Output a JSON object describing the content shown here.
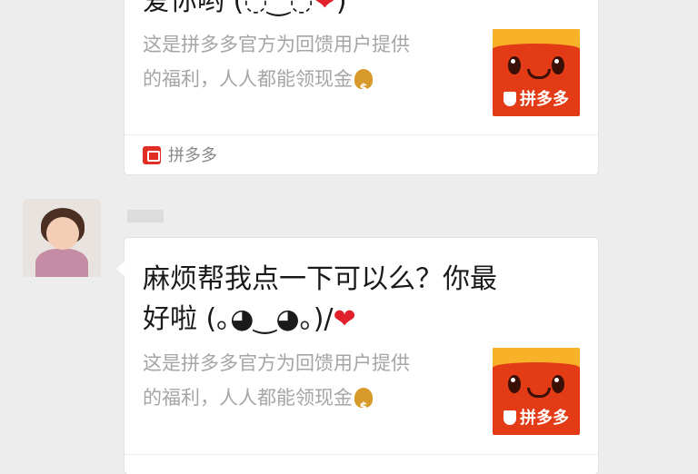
{
  "messages": [
    {
      "title_tail": "爱你哟 (◌‿◌",
      "heart": "❤",
      "title_close": ")",
      "desc_line1": "这是拼多多官方为回馈用户提供",
      "desc_line2": "的福利，人人都能领现金",
      "thumb_brand": "拼多多",
      "source_name": "拼多多"
    },
    {
      "title_line1": "麻烦帮我点一下可以么？你最",
      "title_line2": "好啦 (｡◕‿◕｡)/",
      "heart": "❤",
      "desc_line1": "这是拼多多官方为回馈用户提供",
      "desc_line2": "的福利，人人都能领现金",
      "thumb_brand": "拼多多"
    }
  ],
  "icons": {
    "money_bag": "money-bag-icon",
    "heart": "heart-icon",
    "app_logo": "pinduoduo-logo-icon",
    "shield": "shield-icon"
  },
  "colors": {
    "background": "#ededed",
    "card": "#ffffff",
    "brand_red": "#e23b16",
    "brand_yellow": "#f7b22a",
    "heart": "#e0202a",
    "muted_text": "#a5a5a5"
  }
}
